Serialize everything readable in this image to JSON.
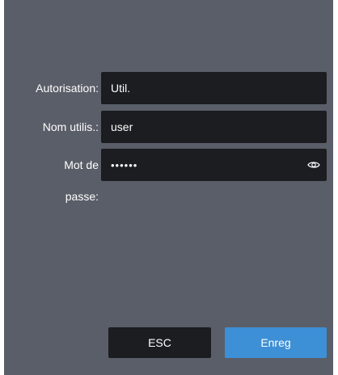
{
  "form": {
    "authorization": {
      "label": "Autorisation:",
      "value": "Util."
    },
    "username": {
      "label": "Nom utilis.:",
      "value": "user"
    },
    "password": {
      "label_line1": "Mot de",
      "label_line2": "passe:",
      "masked_value": "••••••",
      "visibility_icon": "eye-icon"
    }
  },
  "actions": {
    "esc_label": "ESC",
    "save_label": "Enreg"
  },
  "colors": {
    "panel_bg": "#5a5e68",
    "field_bg": "#1c1d21",
    "primary_button": "#3d8fd6",
    "text": "#ffffff"
  }
}
